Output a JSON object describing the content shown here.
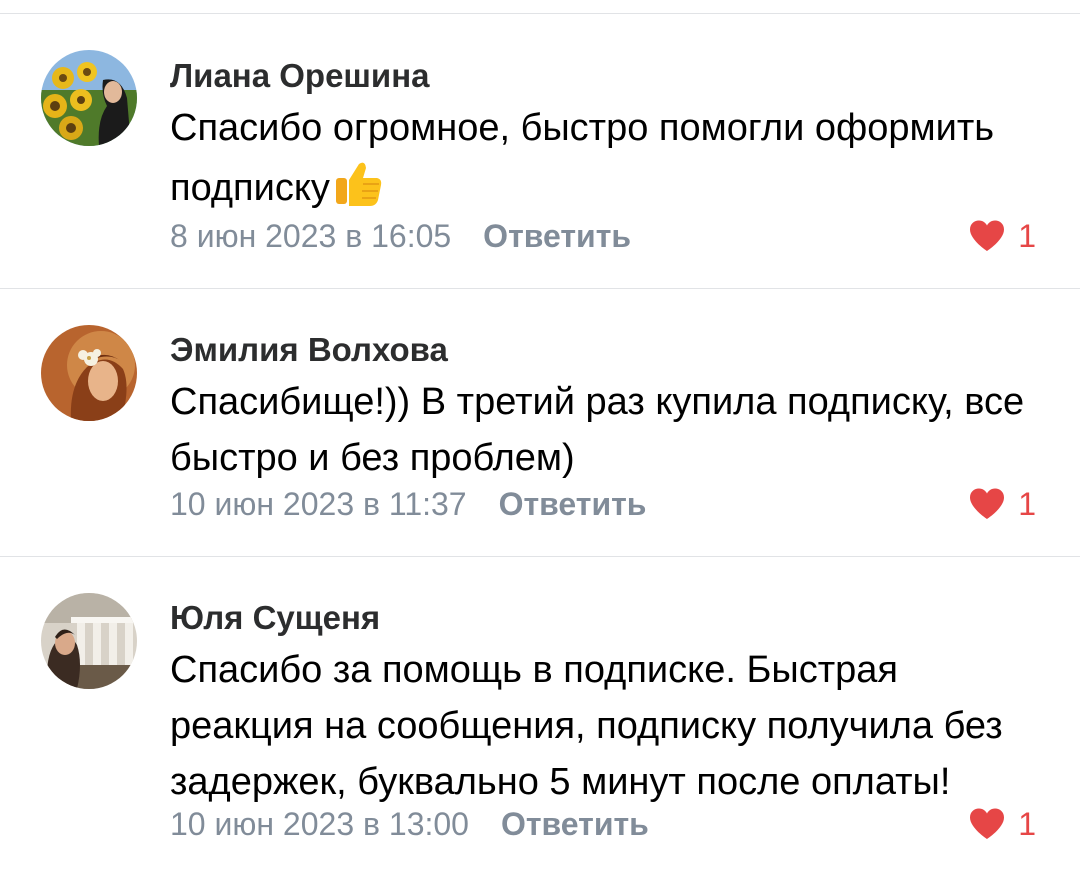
{
  "comments": [
    {
      "author": "Лиана Орешина",
      "text": "Спасибо огромное, быстро помогли оформить подписку",
      "emoji": "thumbs-up-icon",
      "date": "8 июн 2023 в 16:05",
      "reply_label": "Ответить",
      "likes": "1"
    },
    {
      "author": "Эмилия Волхова",
      "text": "Спасибище!)) В третий раз купила подписку, все быстро и без проблем)",
      "date": "10 июн 2023 в 11:37",
      "reply_label": "Ответить",
      "likes": "1"
    },
    {
      "author": "Юля Сущеня",
      "text": "Спасибо за помощь в подписке. Быстрая реакция на сообщения, подписку получила без задержек, буквально 5 минут после оплаты!",
      "date": "10 июн 2023 в 13:00",
      "reply_label": "Ответить",
      "likes": "1"
    }
  ],
  "colors": {
    "like": "#e64646",
    "meta": "#818c99",
    "divider": "#e1e3e6"
  }
}
